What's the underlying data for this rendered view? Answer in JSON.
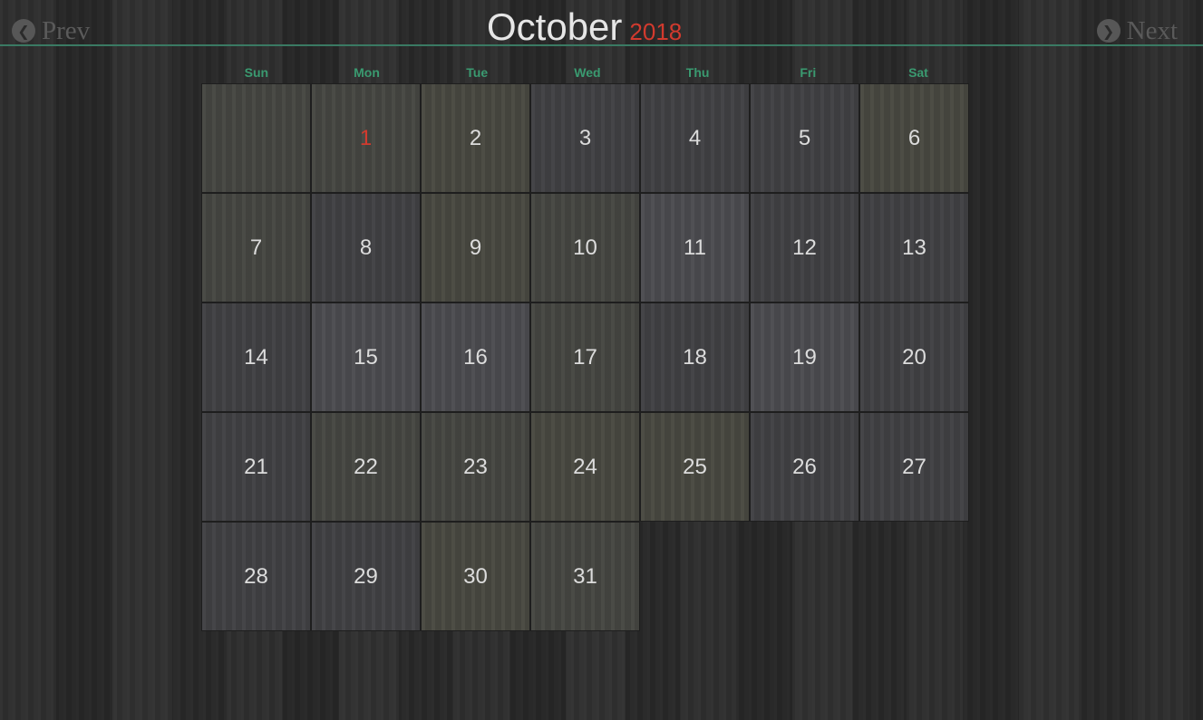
{
  "header": {
    "month": "October",
    "year": "2018",
    "prev_label": "Prev",
    "next_label": "Next"
  },
  "weekdays": [
    "Sun",
    "Mon",
    "Tue",
    "Wed",
    "Thu",
    "Fri",
    "Sat"
  ],
  "days": [
    "",
    "1",
    "2",
    "3",
    "4",
    "5",
    "6",
    "7",
    "8",
    "9",
    "10",
    "11",
    "12",
    "13",
    "14",
    "15",
    "16",
    "17",
    "18",
    "19",
    "20",
    "21",
    "22",
    "23",
    "24",
    "25",
    "26",
    "27",
    "28",
    "29",
    "30",
    "31"
  ],
  "highlighted_day": "1",
  "colors": {
    "accent": "#3a9a70",
    "highlight": "#d23a2e",
    "title": "#e6e6e6"
  }
}
